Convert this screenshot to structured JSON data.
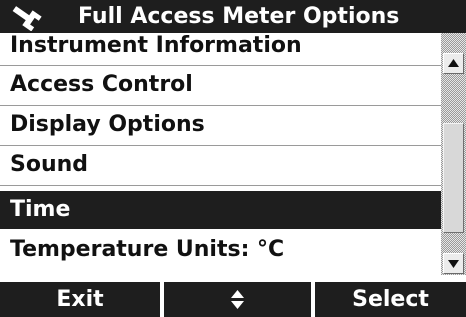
{
  "title_bar": {
    "icon": "wrench-icon",
    "title": "Full Access Meter Options"
  },
  "menu": {
    "items": [
      {
        "label": "Instrument Information",
        "selected": false
      },
      {
        "label": "Access Control",
        "selected": false
      },
      {
        "label": "Display Options",
        "selected": false
      },
      {
        "label": "Sound",
        "selected": false
      },
      {
        "label": "Time",
        "selected": true
      },
      {
        "label": "Temperature Units: °C",
        "selected": false
      }
    ]
  },
  "scrollbar": {
    "up_icon": "arrow-up-icon",
    "down_icon": "arrow-down-icon"
  },
  "softkeys": {
    "left_label": "Exit",
    "middle_icon": "up-down-arrows-icon",
    "right_label": "Select"
  },
  "colors": {
    "bar_background": "#1e1e1e",
    "text_light": "#ffffff",
    "text_dark": "#111111",
    "divider": "#9a9a9a"
  }
}
